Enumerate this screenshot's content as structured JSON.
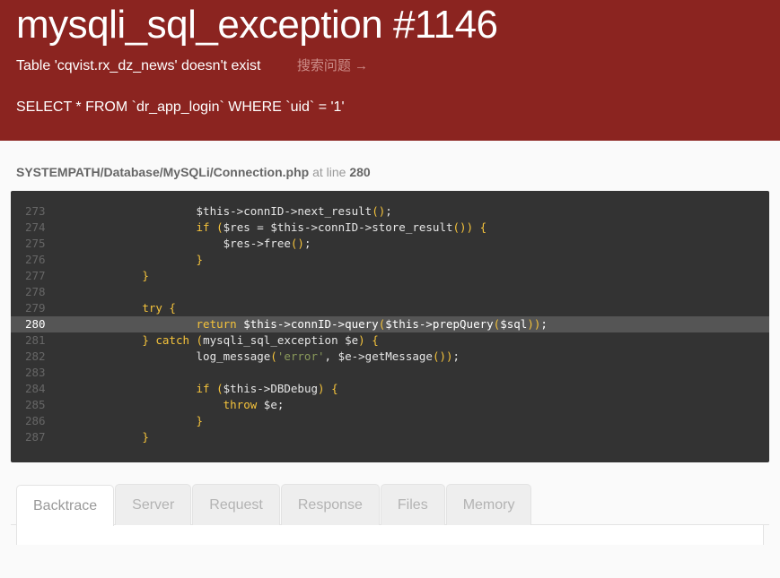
{
  "header": {
    "exception_title": "mysqli_sql_exception #1146",
    "message": "Table 'cqvist.rx_dz_news' doesn't exist",
    "search_link": "搜索问题 →",
    "query": "SELECT * FROM `dr_app_login` WHERE `uid` = '1'",
    "background_color": "#8b2420"
  },
  "source": {
    "file_path": "SYSTEMPATH/Database/MySQLi/Connection.php",
    "at_line_label": "at line",
    "line_number": "280",
    "highlight_line": "280",
    "background_color": "#333333",
    "highlight_color": "#555555",
    "lines": [
      {
        "num": "273",
        "code": "                    $this->connID->next_result();",
        "highlight": false
      },
      {
        "num": "274",
        "code": "                    if ($res = $this->connID->store_result()) {",
        "highlight": false
      },
      {
        "num": "275",
        "code": "                        $res->free();",
        "highlight": false
      },
      {
        "num": "276",
        "code": "                    }",
        "highlight": false
      },
      {
        "num": "277",
        "code": "            }",
        "highlight": false
      },
      {
        "num": "278",
        "code": "",
        "highlight": false
      },
      {
        "num": "279",
        "code": "            try {",
        "highlight": false
      },
      {
        "num": "280",
        "code": "                    return $this->connID->query($this->prepQuery($sql));",
        "highlight": true
      },
      {
        "num": "281",
        "code": "            } catch (mysqli_sql_exception $e) {",
        "highlight": false
      },
      {
        "num": "282",
        "code": "                    log_message('error', $e->getMessage());",
        "highlight": false
      },
      {
        "num": "283",
        "code": "",
        "highlight": false
      },
      {
        "num": "284",
        "code": "                    if ($this->DBDebug) {",
        "highlight": false
      },
      {
        "num": "285",
        "code": "                        throw $e;",
        "highlight": false
      },
      {
        "num": "286",
        "code": "                    }",
        "highlight": false
      },
      {
        "num": "287",
        "code": "            }",
        "highlight": false
      }
    ]
  },
  "tabs": {
    "active": "Backtrace",
    "items": [
      {
        "label": "Backtrace",
        "active": true
      },
      {
        "label": "Server",
        "active": false
      },
      {
        "label": "Request",
        "active": false
      },
      {
        "label": "Response",
        "active": false
      },
      {
        "label": "Files",
        "active": false
      },
      {
        "label": "Memory",
        "active": false
      }
    ]
  }
}
